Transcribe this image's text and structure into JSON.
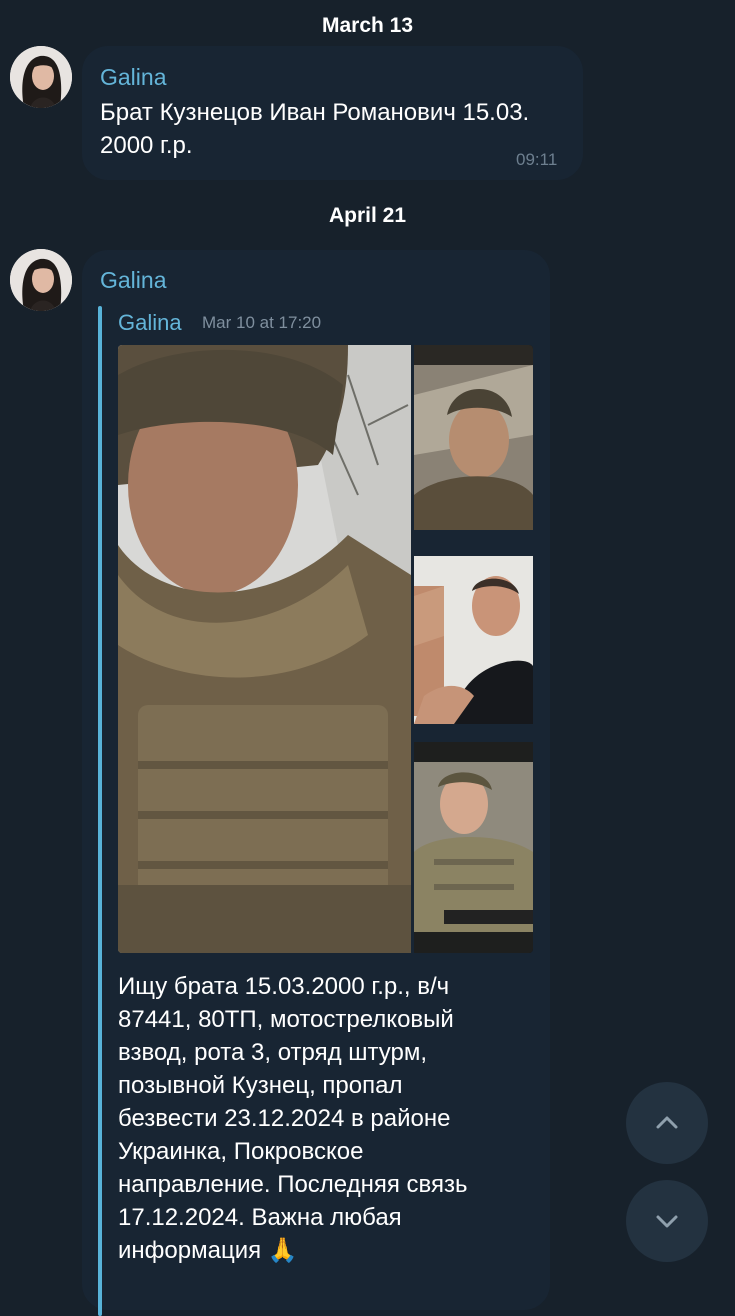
{
  "chat": {
    "messages": [
      {
        "date_separator": "March 13",
        "sender": "Galina",
        "text_lines": [
          "Брат Кузнецов Иван Романович 15.03.",
          "2000 г.р."
        ],
        "time": "09:11"
      },
      {
        "date_separator": "April 21",
        "sender": "Galina",
        "reply": {
          "sender": "Galina",
          "date": "Mar 10 at 17:20"
        },
        "text_lines": [
          "Ищу брата 15.03.2000 г.р., в/ч",
          "87441, 80ТП, мотострелковый",
          "взвод, рота 3, отряд штурм,",
          "позывной Кузнец, пропал",
          "безвести 23.12.2024 в районе",
          "Украинка, Покровское",
          "направление. Последняя связь",
          "17.12.2024. Важна любая",
          "информация 🙏"
        ]
      }
    ]
  },
  "icons": {
    "scroll_up": "chevron-up-icon",
    "scroll_down": "chevron-down-icon"
  },
  "colors": {
    "background": "#17212b",
    "bubble": "#182533",
    "accent": "#64b5d9",
    "fab": "#233240"
  }
}
